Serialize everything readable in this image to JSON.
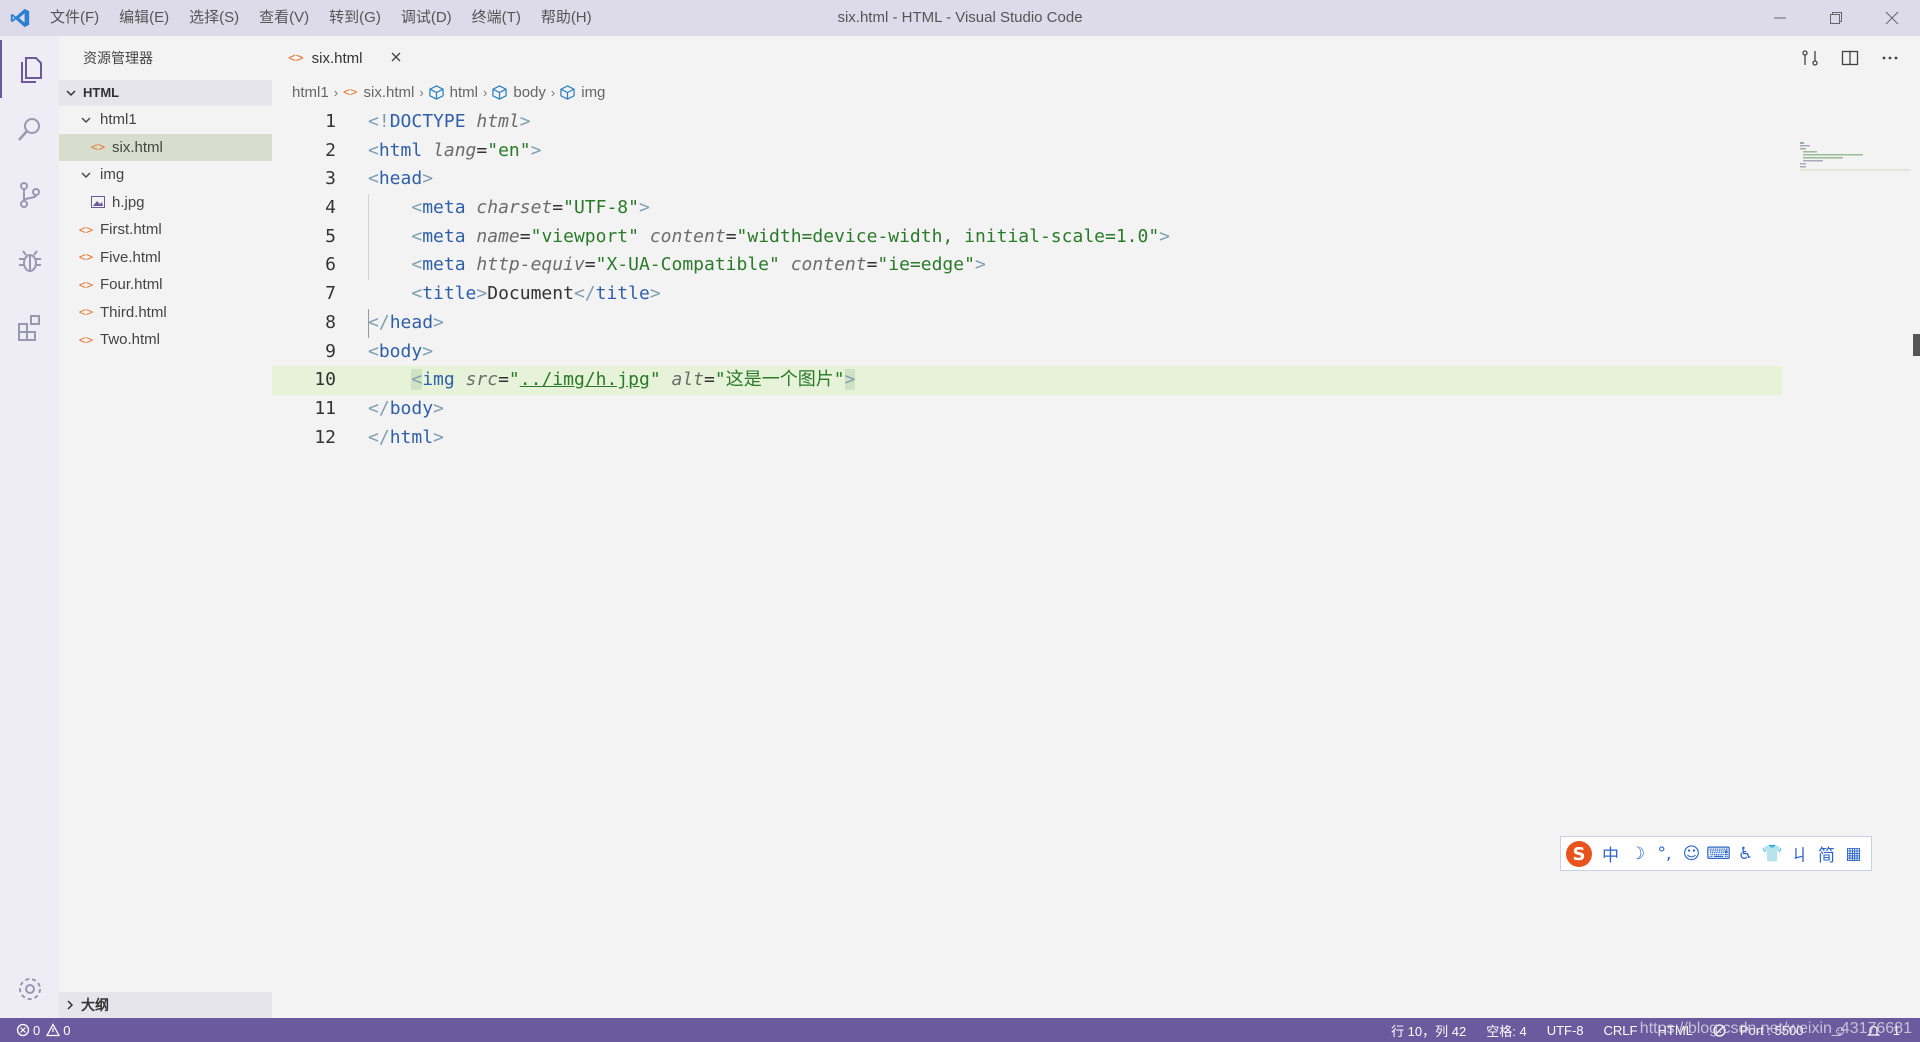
{
  "titlebar": {
    "menu": [
      "文件(F)",
      "编辑(E)",
      "选择(S)",
      "查看(V)",
      "转到(G)",
      "调试(D)",
      "终端(T)",
      "帮助(H)"
    ],
    "title": "six.html - HTML - Visual Studio Code"
  },
  "sidebar": {
    "title": "资源管理器",
    "section": "HTML",
    "tree": [
      {
        "label": "html1",
        "type": "folder"
      },
      {
        "label": "six.html",
        "type": "html",
        "selected": true
      },
      {
        "label": "img",
        "type": "folder"
      },
      {
        "label": "h.jpg",
        "type": "image"
      },
      {
        "label": "First.html",
        "type": "html"
      },
      {
        "label": "Five.html",
        "type": "html"
      },
      {
        "label": "Four.html",
        "type": "html"
      },
      {
        "label": "Third.html",
        "type": "html"
      },
      {
        "label": "Two.html",
        "type": "html"
      }
    ],
    "outline": "大纲"
  },
  "tab": {
    "label": "six.html"
  },
  "breadcrumbs": [
    "html1",
    "six.html",
    "html",
    "body",
    "img"
  ],
  "code": {
    "current_line": 10,
    "line_numbers": [
      "1",
      "2",
      "3",
      "4",
      "5",
      "6",
      "7",
      "8",
      "9",
      "10",
      "11",
      "12"
    ]
  },
  "ime": [
    "中",
    "☽",
    "°,",
    "☺",
    "⌨",
    "♿",
    "👕",
    "ㄐ",
    "简",
    "▦"
  ],
  "status": {
    "errors": "0",
    "warnings": "0",
    "position": "行 10，列 42",
    "spaces": "空格: 4",
    "encoding": "UTF-8",
    "eol": "CRLF",
    "language": "HTML",
    "port": "Port : 5500",
    "notifications": "1"
  },
  "watermark": "https://blog.csdn.net/weixin_43176681",
  "colors": {
    "accent": "#6c5a9e",
    "titlebar": "#dddbe9",
    "current_line": "#e6f3d9"
  }
}
